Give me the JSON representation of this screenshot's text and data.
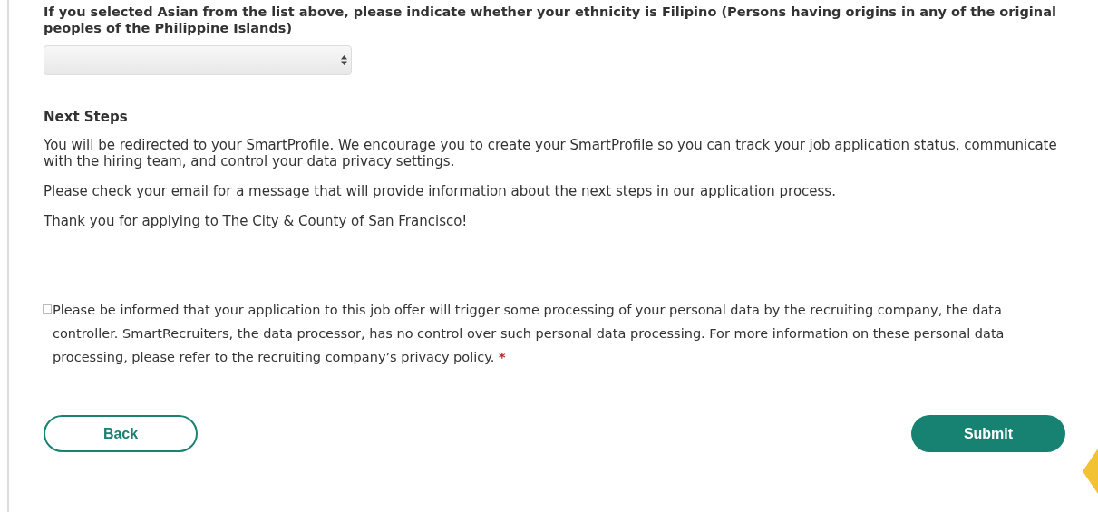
{
  "question": {
    "label": "If you selected Asian from the list above, please indicate whether your ethnicity is Filipino (Persons having origins in any of the original peoples of the Philippine Islands)"
  },
  "next_steps": {
    "heading": "Next Steps",
    "paragraphs": [
      "You will be redirected to your SmartProfile. We encourage you to create your SmartProfile so you can track your job application status, communicate with the hiring team, and control your data privacy settings.",
      "Please check your email for a message that will provide information about the next steps in our application process.",
      "Thank you for applying to The City & County of San Francisco!"
    ]
  },
  "consent": {
    "checked": false,
    "text": "Please be informed that your application to this job offer will trigger some processing of your personal data by the recruiting company, the data controller. SmartRecruiters, the data processor, has no control over such personal data processing. For more information on these personal data processing, please refer to the recruiting company’s privacy policy.",
    "required_mark": "*"
  },
  "buttons": [
    {
      "label": "Back",
      "kind": "secondary"
    },
    {
      "label": "Submit",
      "kind": "primary"
    }
  ]
}
